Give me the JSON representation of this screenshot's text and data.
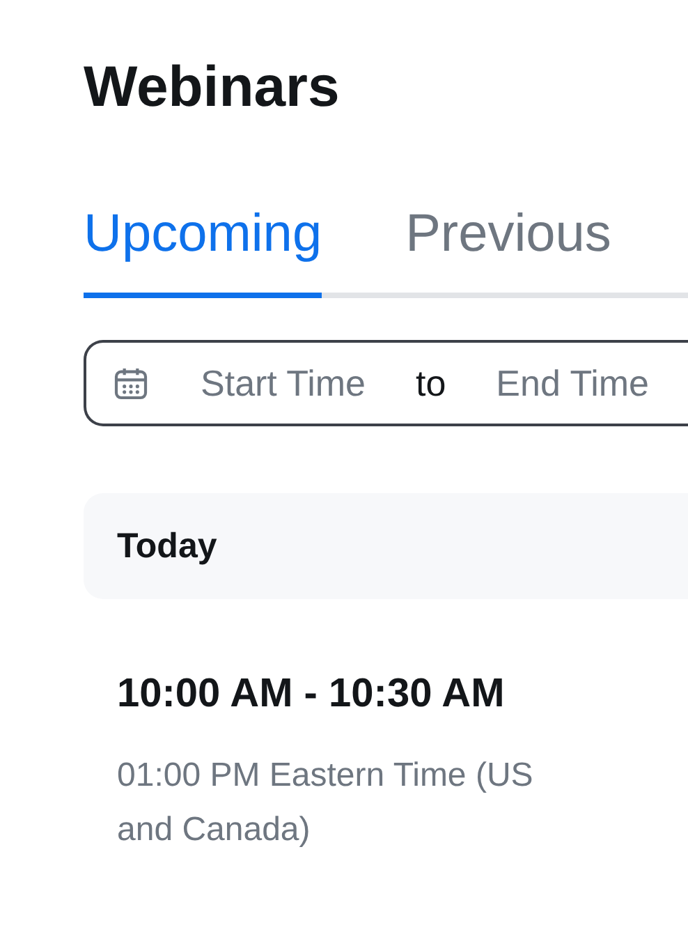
{
  "title": "Webinars",
  "tabs": [
    {
      "label": "Upcoming",
      "selected": true
    },
    {
      "label": "Previous",
      "selected": false
    }
  ],
  "date_range": {
    "start_placeholder": "Start Time",
    "separator": "to",
    "end_placeholder": "End Time"
  },
  "section": {
    "heading": "Today"
  },
  "webinars": [
    {
      "time": "10:00 AM - 10:30 AM",
      "local_time": "01:00 PM Eastern Time (US and Canada)"
    }
  ]
}
